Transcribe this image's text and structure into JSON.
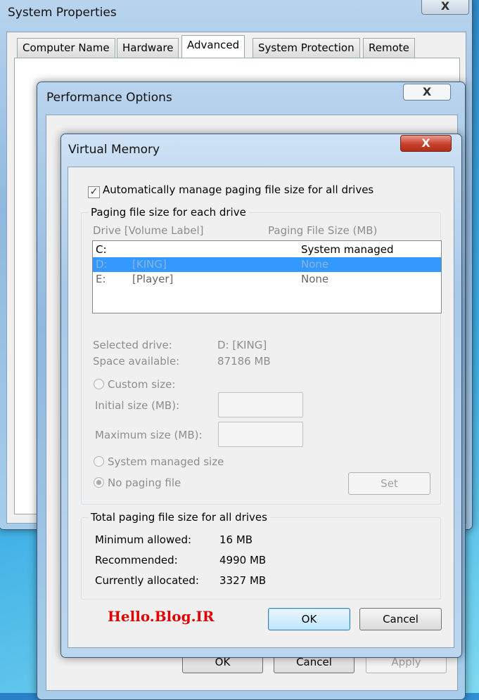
{
  "system_properties": {
    "title": "System Properties",
    "close": "X",
    "tabs": [
      "Computer Name",
      "Hardware",
      "Advanced",
      "System Protection",
      "Remote"
    ],
    "active_tab": "Advanced"
  },
  "performance_options": {
    "title": "Performance Options",
    "close": "X",
    "buttons": {
      "ok": "OK",
      "cancel": "Cancel",
      "apply": "Apply"
    }
  },
  "virtual_memory": {
    "title": "Virtual Memory",
    "close": "X",
    "auto_manage_label": "Automatically manage paging file size for all drives",
    "auto_manage_checked": true,
    "paging_group": "Paging file size for each drive",
    "col_drive": "Drive  [Volume Label]",
    "col_size": "Paging File Size (MB)",
    "drives": [
      {
        "drive": "C:",
        "label": "",
        "size": "System managed"
      },
      {
        "drive": "D:",
        "label": "[KING]",
        "size": "None",
        "selected": true
      },
      {
        "drive": "E:",
        "label": "[Player]",
        "size": "None"
      }
    ],
    "selected_drive_label": "Selected drive:",
    "selected_drive_value": "D:  [KING]",
    "space_label": "Space available:",
    "space_value": "87186 MB",
    "custom_size": "Custom size:",
    "initial_size": "Initial size (MB):",
    "initial_value": "",
    "maximum_size": "Maximum size (MB):",
    "maximum_value": "",
    "system_managed": "System managed size",
    "no_paging": "No paging file",
    "set": "Set",
    "total_group": "Total paging file size for all drives",
    "min_label": "Minimum allowed:",
    "min_value": "16 MB",
    "rec_label": "Recommended:",
    "rec_value": "4990 MB",
    "cur_label": "Currently allocated:",
    "cur_value": "3327 MB",
    "ok": "OK",
    "cancel": "Cancel"
  },
  "watermark": "Hello.Blog.IR",
  "colors": {
    "selection": "#3399ff",
    "watermark": "#e00000"
  }
}
